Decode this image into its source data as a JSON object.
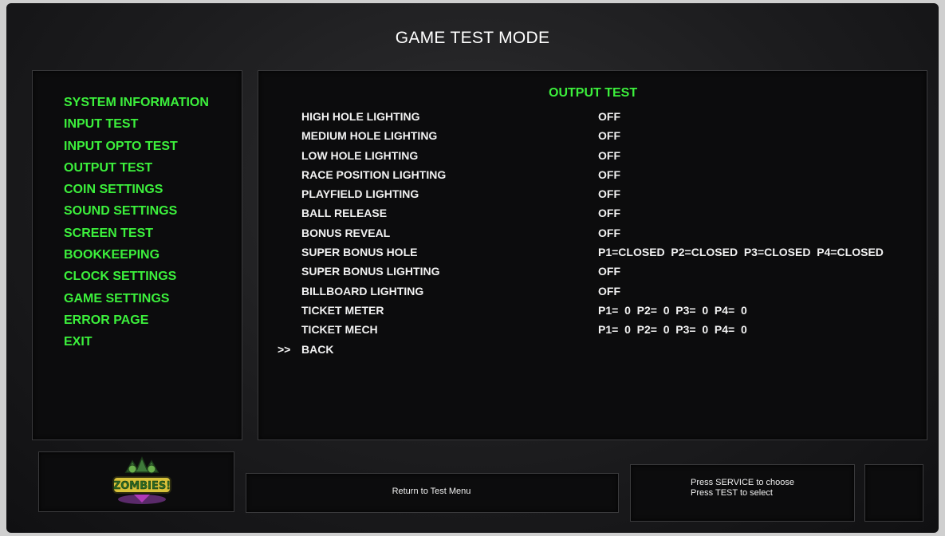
{
  "header": {
    "title": "GAME TEST MODE"
  },
  "sidebar": {
    "items": [
      {
        "label": "SYSTEM INFORMATION"
      },
      {
        "label": "INPUT TEST"
      },
      {
        "label": "INPUT OPTO TEST"
      },
      {
        "label": "OUTPUT TEST"
      },
      {
        "label": "COIN SETTINGS"
      },
      {
        "label": "SOUND SETTINGS"
      },
      {
        "label": "SCREEN TEST"
      },
      {
        "label": "BOOKKEEPING"
      },
      {
        "label": "CLOCK SETTINGS"
      },
      {
        "label": "GAME SETTINGS"
      },
      {
        "label": "ERROR PAGE"
      },
      {
        "label": "EXIT"
      }
    ],
    "item_color": "#3cf03c"
  },
  "main": {
    "section_title": "OUTPUT TEST",
    "rows": [
      {
        "cursor": "",
        "label": "HIGH HOLE LIGHTING",
        "value": "OFF"
      },
      {
        "cursor": "",
        "label": "MEDIUM HOLE LIGHTING",
        "value": "OFF"
      },
      {
        "cursor": "",
        "label": "LOW HOLE LIGHTING",
        "value": "OFF"
      },
      {
        "cursor": "",
        "label": "RACE POSITION LIGHTING",
        "value": "OFF"
      },
      {
        "cursor": "",
        "label": "PLAYFIELD LIGHTING",
        "value": "OFF"
      },
      {
        "cursor": "",
        "label": "BALL RELEASE",
        "value": "OFF"
      },
      {
        "cursor": "",
        "label": "BONUS REVEAL",
        "value": "OFF"
      },
      {
        "cursor": "",
        "label": "SUPER BONUS HOLE",
        "value": "P1=CLOSED  P2=CLOSED  P3=CLOSED  P4=CLOSED"
      },
      {
        "cursor": "",
        "label": "SUPER BONUS LIGHTING",
        "value": "OFF"
      },
      {
        "cursor": "",
        "label": "BILLBOARD LIGHTING",
        "value": "OFF"
      },
      {
        "cursor": "",
        "label": "TICKET METER",
        "value": "P1=  0  P2=  0  P3=  0  P4=  0"
      },
      {
        "cursor": "",
        "label": "TICKET MECH",
        "value": "P1=  0  P2=  0  P3=  0  P4=  0"
      },
      {
        "cursor": ">>",
        "label": "BACK",
        "value": ""
      }
    ]
  },
  "footer": {
    "logo_text": "ZOMBIES!",
    "hint": "Return to Test Menu",
    "help_line1": "Press SERVICE to choose",
    "help_line2": "Press TEST to select"
  }
}
